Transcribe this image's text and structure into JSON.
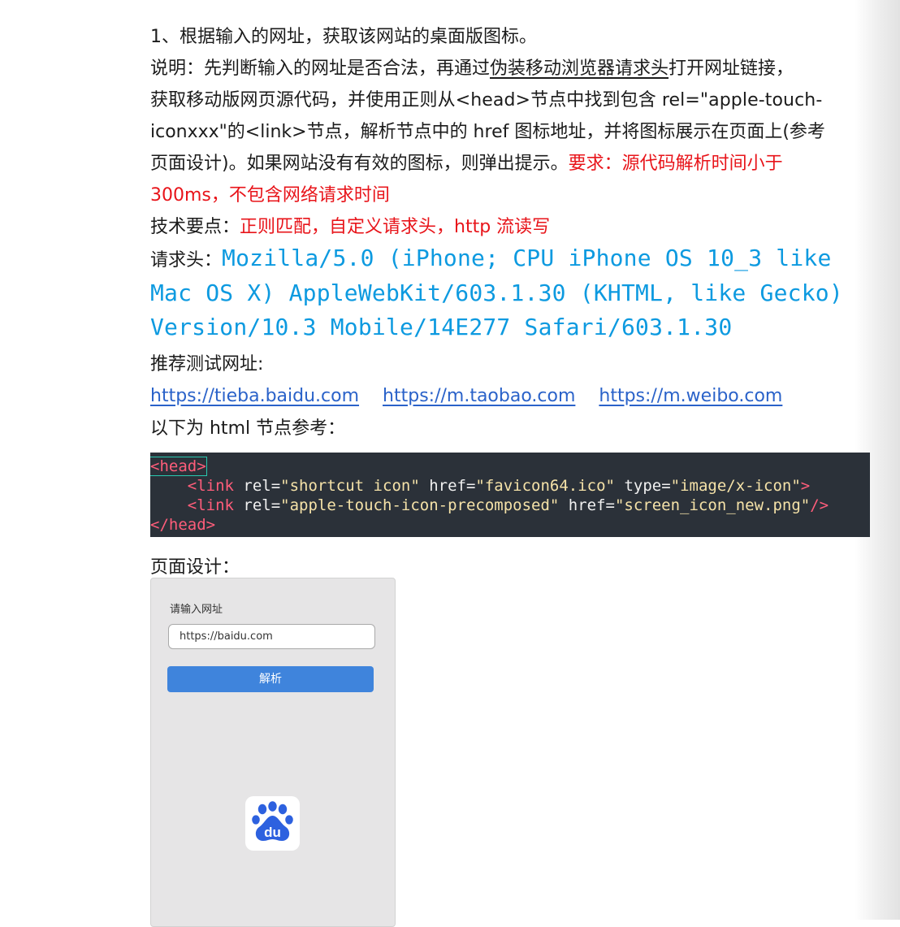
{
  "doc": {
    "heading": "1、根据输入的网址，获取该网站的桌面版图标。",
    "desc_prefix": "说明：先判断输入的网址是否合法，再通过",
    "desc_underlined": "伪装移动浏览器请求头",
    "desc_line1_end": "打开网址链接，",
    "desc_line2": "获取移动版网页源代码，并使用正则从<head>节点中找到包含 rel=\"apple-touch-",
    "desc_line3": "iconxxx\"的<link>节点，解析节点中的 href 图标地址，并将图标展示在页面上(参考",
    "desc_line4_start": "页面设计)。如果网站没有有效的图标，则弹出提示。",
    "desc_line4_red": "要求：源代码解析时间小于",
    "desc_line5_red": "300ms，不包含网络请求时间",
    "tech_label": "技术要点：",
    "tech_value": "正则匹配，自定义请求头，http 流读写",
    "ua_label": "请求头：",
    "ua_line1": "Mozilla/5.0 (iPhone; CPU iPhone OS 10_3 like",
    "ua_line2": "Mac OS X) AppleWebKit/603.1.30 (KHTML, like Gecko)",
    "ua_line3": "Version/10.3 Mobile/14E277 Safari/603.1.30",
    "test_label": "推荐测试网址:",
    "test_urls": [
      "https://tieba.baidu.com",
      "https://m.taobao.com",
      "https://m.weibo.com"
    ],
    "html_ref_label": "以下为 html 节点参考：",
    "design_label": "页面设计："
  },
  "code": {
    "line1": {
      "open": "<",
      "tag": "head",
      "close": ">"
    },
    "line2": {
      "indent": "    ",
      "tag": "<link",
      "attr1": " rel=",
      "val1": "\"shortcut icon\"",
      "attr2": " href=",
      "val2": "\"favicon64.ico\"",
      "attr3": " type=",
      "val3": "\"image/x-icon\"",
      "end": ">"
    },
    "line3": {
      "indent": "    ",
      "tag": "<link",
      "attr1": " rel=",
      "val1": "\"apple-touch-icon-precomposed\"",
      "attr2": " href=",
      "val2": "\"screen_icon_new.png\"",
      "end": "/>"
    },
    "line4": "</head>"
  },
  "phone": {
    "label": "请输入网址",
    "input_value": "https://baidu.com",
    "button_label": "解析",
    "icon_text": "du",
    "icon": "baidu-paw-icon"
  },
  "colors": {
    "red": "#e8141a",
    "ua_blue": "#0d9ae0",
    "link_blue": "#2a62c9",
    "button_blue": "#3f84dc",
    "code_bg": "#2b3139"
  }
}
